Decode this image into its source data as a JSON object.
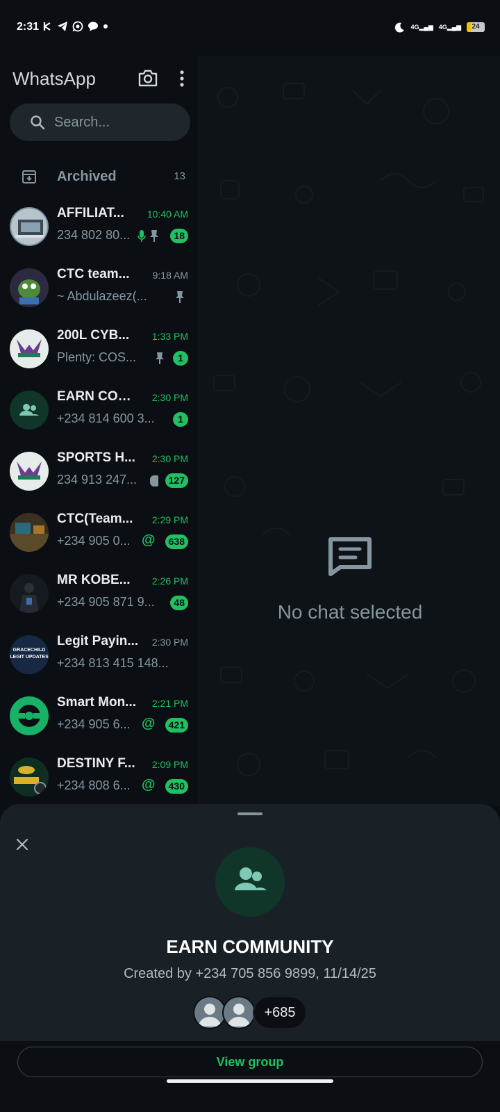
{
  "status_bar": {
    "time": "2:31",
    "network_1": "4G",
    "network_2": "4G",
    "battery": "24"
  },
  "header": {
    "title": "WhatsApp",
    "search_placeholder": "Search..."
  },
  "archived": {
    "label": "Archived",
    "count": "13"
  },
  "chats": [
    {
      "name": "AFFILIAT...",
      "time": "10:40 AM",
      "preview": "234 802 80...",
      "badge": "18",
      "time_green": true
    },
    {
      "name": "CTC team...",
      "time": "9:18 AM",
      "preview": "~ Abdulazeez(...",
      "badge": "",
      "time_green": false
    },
    {
      "name": "200L  CYB...",
      "time": "1:33 PM",
      "preview": "Plenty: COS...",
      "badge": "1",
      "time_green": true
    },
    {
      "name": "EARN COM...",
      "time": "2:30 PM",
      "preview": "+234 814 600 3...",
      "badge": "1",
      "time_green": true
    },
    {
      "name": "SPORTS H...",
      "time": "2:30 PM",
      "preview": "234 913 247...",
      "badge": "127",
      "time_green": true
    },
    {
      "name": "CTC(Team...",
      "time": "2:29 PM",
      "preview": "+234 905 0...",
      "badge": "638",
      "mention": "@",
      "time_green": true
    },
    {
      "name": "MR KOBE...",
      "time": "2:26 PM",
      "preview": "+234 905 871 9...",
      "badge": "48",
      "time_green": true
    },
    {
      "name": "Legit Payin...",
      "time": "2:30 PM",
      "preview": "+234 813 415 148...",
      "badge": "",
      "time_green": false
    },
    {
      "name": "Smart Mon...",
      "time": "2:21 PM",
      "preview": "+234 905 6...",
      "badge": "421",
      "mention": "@",
      "time_green": true
    },
    {
      "name": "DESTINY F...",
      "time": "2:09 PM",
      "preview": "+234 808 6...",
      "badge": "430",
      "mention": "@",
      "time_green": true
    }
  ],
  "avatar_texts": {
    "legit": "GRACECHILD LEGIT UPDATES"
  },
  "right_pane": {
    "empty_text": "No chat selected"
  },
  "sheet": {
    "community_name": "EARN COMMUNITY",
    "created_by": "Created by +234 705 856 9899, 11/14/25",
    "member_more": "+685",
    "view_group": "View group"
  },
  "colors": {
    "accent_green": "#21c063",
    "background": "#0b0f13",
    "sheet": "#1a2126"
  }
}
